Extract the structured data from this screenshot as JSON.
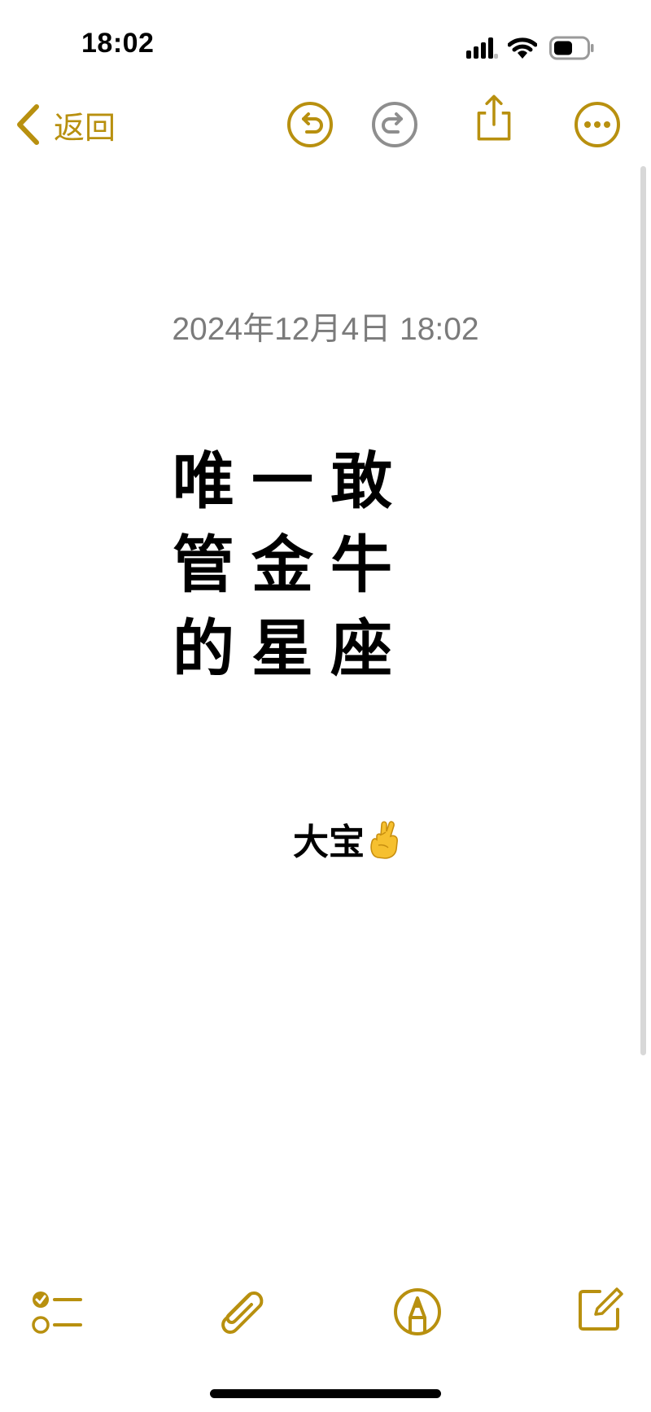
{
  "status_bar": {
    "time": "18:02"
  },
  "nav": {
    "back_label": "返回",
    "icons": [
      "chevron-left-icon",
      "undo-icon",
      "redo-icon",
      "share-icon",
      "more-icon"
    ]
  },
  "note": {
    "date": "2024年12月4日 18:02",
    "title_lines": [
      [
        "唯",
        "一",
        "敢"
      ],
      [
        "管",
        "金",
        "牛"
      ],
      [
        "的",
        "星",
        "座"
      ]
    ],
    "signature": "大宝",
    "signature_emoji_icon": "crossed-fingers-emoji"
  },
  "toolbar": {
    "icons": [
      "checklist-icon",
      "paperclip-icon",
      "markup-pen-icon",
      "compose-icon"
    ]
  },
  "colors": {
    "accent": "#b8900f",
    "inactive_icon": "#8e8e8e",
    "date_text": "#7b7b7b",
    "background": "#ffffff"
  }
}
